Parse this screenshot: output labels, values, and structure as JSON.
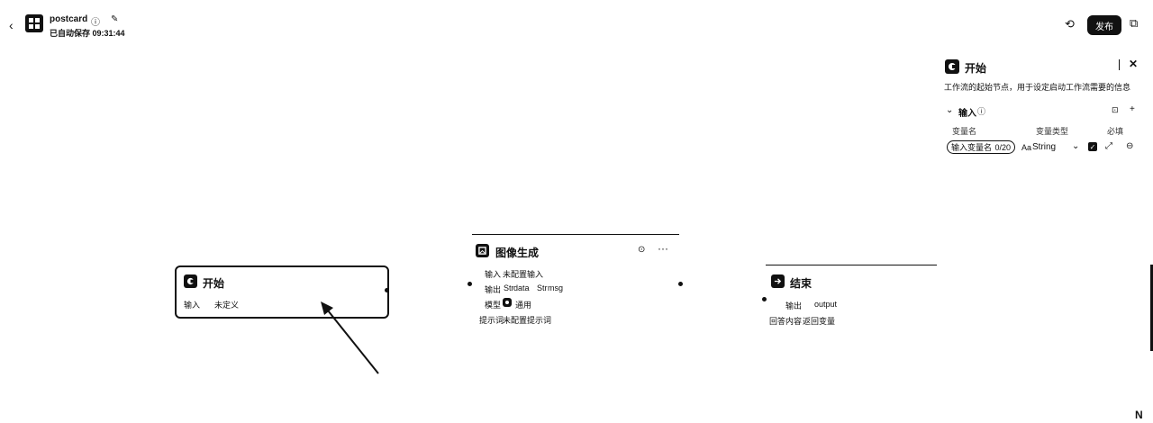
{
  "header": {
    "back_icon": "chevron-left-icon",
    "app_icon": "workflow-icon",
    "title": "postcard",
    "subtitle": "已自动保存 09:31:44",
    "publish_label": "发布"
  },
  "panel": {
    "title": "开始",
    "description": "工作流的起始节点，用于设定启动工作流需要的信息",
    "section_title": "输入",
    "columns": [
      "变量名",
      "变量类型",
      "必填"
    ],
    "var_name_placeholder": "输入变量名",
    "char_count": "0/20",
    "var_type": "String"
  },
  "nodes": {
    "start": {
      "title": "开始",
      "input_label": "输入",
      "input_value": "未定义"
    },
    "image_gen": {
      "title": "图像生成",
      "input_label": "输入",
      "input_value": "未配置输入",
      "output_label": "输出",
      "outputs": [
        "data",
        "msg"
      ],
      "output_tags": [
        "Str",
        "Str"
      ],
      "model_label": "模型",
      "model_value": "通用",
      "prompt_label": "提示词",
      "prompt_value": "未配置提示词"
    },
    "end": {
      "title": "结束",
      "output_label": "输出",
      "output_value": "output",
      "answer_label": "回答内容",
      "answer_value": "返回变量"
    }
  }
}
